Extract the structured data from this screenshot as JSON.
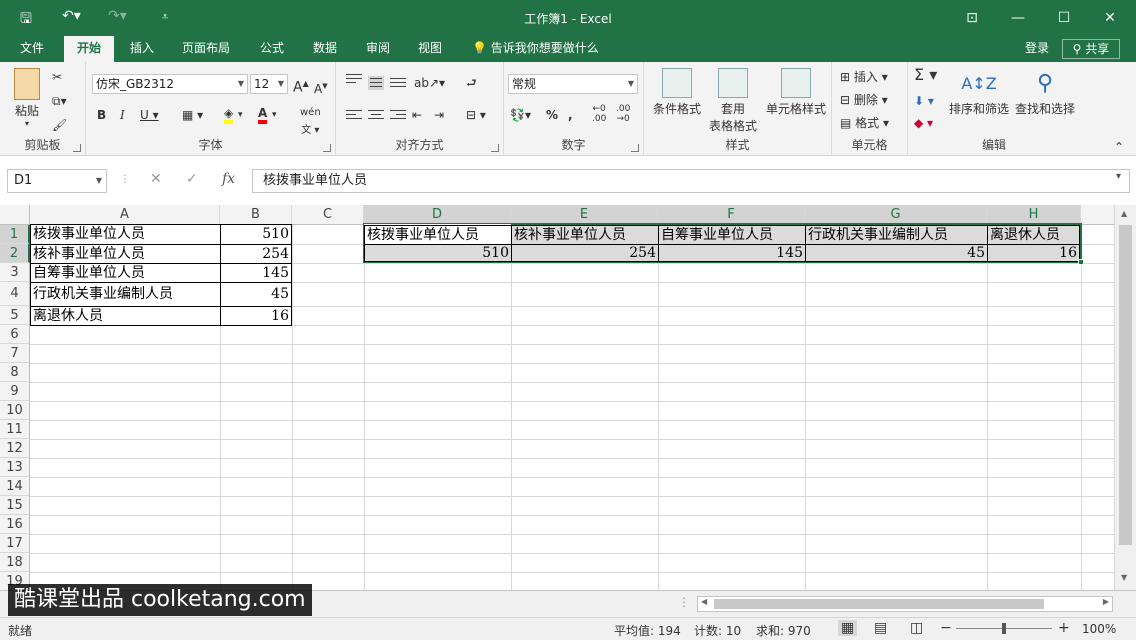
{
  "title_bar": {
    "window_title": "工作簿1 - Excel",
    "icons": [
      "save-icon",
      "undo-icon",
      "redo-icon",
      "customize-icon"
    ]
  },
  "tabs": [
    "文件",
    "开始",
    "插入",
    "页面布局",
    "公式",
    "数据",
    "审阅",
    "视图"
  ],
  "active_tab": "开始",
  "tell_me": "告诉我你想要做什么",
  "login": "登录",
  "share": "共享",
  "ribbon": {
    "clipboard": {
      "label": "剪贴板",
      "paste": "粘贴"
    },
    "font": {
      "label": "字体",
      "font_name": "仿宋_GB2312",
      "font_size": "12"
    },
    "alignment": {
      "label": "对齐方式"
    },
    "number": {
      "label": "数字",
      "format": "常规"
    },
    "styles": {
      "label": "样式",
      "conditional": "条件格式",
      "table_line1": "套用",
      "table_line2": "表格格式",
      "cell_styles": "单元格样式"
    },
    "cells": {
      "label": "单元格",
      "insert": "插入",
      "delete": "删除",
      "format": "格式"
    },
    "editing": {
      "label": "编辑",
      "sort": "排序和筛选",
      "find": "查找和选择"
    }
  },
  "formula_bar": {
    "name_box": "D1",
    "formula": "核拨事业单位人员"
  },
  "columns": [
    "A",
    "B",
    "C",
    "D",
    "E",
    "F",
    "G",
    "H"
  ],
  "rows": [
    "1",
    "2",
    "3",
    "4",
    "5",
    "6",
    "7",
    "8",
    "9",
    "10",
    "11",
    "12",
    "13",
    "14",
    "15",
    "16",
    "17",
    "18",
    "19"
  ],
  "sheet": {
    "a_col": [
      "核拨事业单位人员",
      "核补事业单位人员",
      "自筹事业单位人员",
      "行政机关事业编制人员",
      "离退休人员"
    ],
    "b_col": [
      "510",
      "254",
      "145",
      "45",
      "16"
    ],
    "row1_headers": [
      "核拨事业单位人员",
      "核补事业单位人员",
      "自筹事业单位人员",
      "行政机关事业编制人员",
      "离退休人员"
    ],
    "row2_values": [
      "510",
      "254",
      "145",
      "45",
      "16"
    ]
  },
  "watermark": "酷课堂出品 coolketang.com",
  "status": {
    "ready": "就绪",
    "average": "平均值: 194",
    "count": "计数: 10",
    "sum": "求和: 970",
    "zoom": "100%"
  }
}
